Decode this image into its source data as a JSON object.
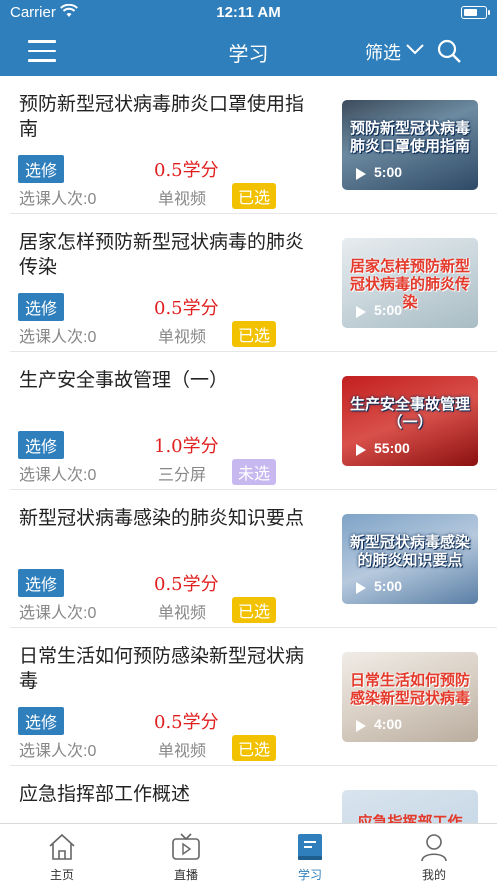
{
  "status_bar": {
    "carrier": "Carrier",
    "time": "12:11 AM"
  },
  "header": {
    "title": "学习",
    "filter_label": "筛选"
  },
  "courses": [
    {
      "title": "预防新型冠状病毒肺炎口罩使用指南",
      "elective": "选修",
      "credit": "0.5学分",
      "count": "选课人次:0",
      "format": "单视频",
      "status": "已选",
      "thumb_caption": "预防新型冠状病毒肺炎口罩使用指南",
      "duration": "5:00"
    },
    {
      "title": "居家怎样预防新型冠状病毒的肺炎传染",
      "elective": "选修",
      "credit": "0.5学分",
      "count": "选课人次:0",
      "format": "单视频",
      "status": "已选",
      "thumb_caption": "居家怎样预防新型冠状病毒的肺炎传染",
      "duration": "5:00"
    },
    {
      "title": "生产安全事故管理（一）",
      "elective": "选修",
      "credit": "1.0学分",
      "count": "选课人次:0",
      "format": "三分屏",
      "status": "未选",
      "thumb_caption": "生产安全事故管理（一）",
      "duration": "55:00"
    },
    {
      "title": "新型冠状病毒感染的肺炎知识要点",
      "elective": "选修",
      "credit": "0.5学分",
      "count": "选课人次:0",
      "format": "单视频",
      "status": "已选",
      "thumb_caption": "新型冠状病毒感染的肺炎知识要点",
      "duration": "5:00"
    },
    {
      "title": "日常生活如何预防感染新型冠状病毒",
      "elective": "选修",
      "credit": "0.5学分",
      "count": "选课人次:0",
      "format": "单视频",
      "status": "已选",
      "thumb_caption": "日常生活如何预防感染新型冠状病毒",
      "duration": "4:00"
    },
    {
      "title": "应急指挥部工作概述",
      "thumb_caption": "应急指挥部工作"
    }
  ],
  "tabs": [
    {
      "label": "主页",
      "icon": "home-icon"
    },
    {
      "label": "直播",
      "icon": "tv-icon"
    },
    {
      "label": "学习",
      "icon": "book-icon",
      "active": true
    },
    {
      "label": "我的",
      "icon": "user-icon"
    }
  ],
  "colors": {
    "primary": "#2f7fbc",
    "credit": "#e02020",
    "selected_badge": "#f2c200",
    "unselected_badge": "#c7b8f0"
  }
}
